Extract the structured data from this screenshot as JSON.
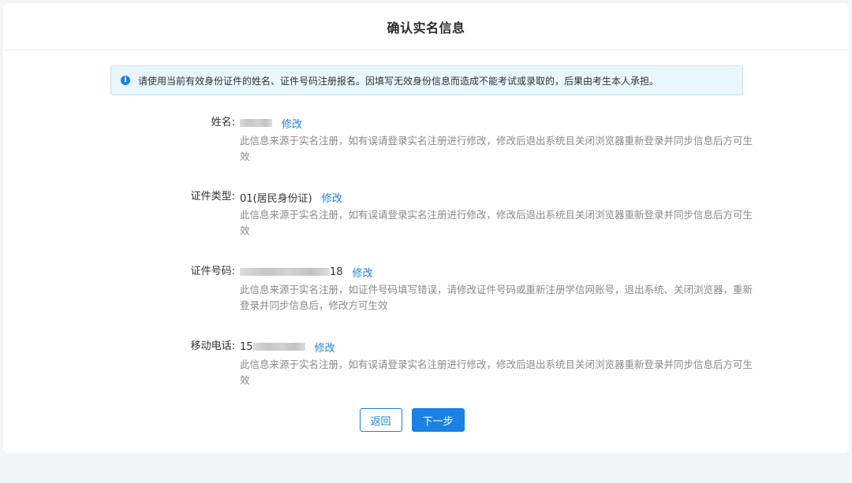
{
  "page": {
    "title": "确认实名信息"
  },
  "notice": {
    "icon": "info-icon",
    "text": "请使用当前有效身份证件的姓名、证件号码注册报名。因填写无效身份信息而造成不能考试或录取的，后果由考生本人承担。"
  },
  "fields": [
    {
      "label": "姓名:",
      "value_prefix": "",
      "value_suffix": "",
      "masked": true,
      "edit_label": "修改",
      "description": "此信息来源于实名注册，如有误请登录实名注册进行修改，修改后退出系统且关闭浏览器重新登录并同步信息后方可生效"
    },
    {
      "label": "证件类型:",
      "value_prefix": "01(居民身份证)",
      "value_suffix": "",
      "masked": false,
      "edit_label": "修改",
      "description": "此信息来源于实名注册，如有误请登录实名注册进行修改，修改后退出系统且关闭浏览器重新登录并同步信息后方可生效"
    },
    {
      "label": "证件号码:",
      "value_prefix": "",
      "value_suffix": "18",
      "masked": true,
      "edit_label": "修改",
      "description": "此信息来源于实名注册，如证件号码填写错误，请修改证件号码或重新注册学信网账号，退出系统、关闭浏览器，重新登录并同步信息后，修改方可生效"
    },
    {
      "label": "移动电话:",
      "value_prefix": "15",
      "value_suffix": "",
      "masked": true,
      "edit_label": "修改",
      "description": "此信息来源于实名注册，如有误请登录实名注册进行修改，修改后退出系统且关闭浏览器重新登录并同步信息后方可生效"
    }
  ],
  "buttons": {
    "back_label": "返回",
    "next_label": "下一步"
  },
  "colors": {
    "accent": "#1a82e2",
    "notice_bg": "#e9f6fe",
    "page_bg": "#f4f5f7"
  }
}
